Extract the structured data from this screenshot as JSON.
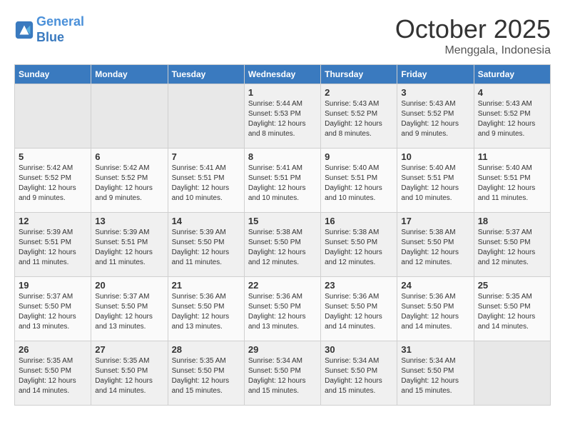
{
  "header": {
    "logo_line1": "General",
    "logo_line2": "Blue",
    "month": "October 2025",
    "location": "Menggala, Indonesia"
  },
  "weekdays": [
    "Sunday",
    "Monday",
    "Tuesday",
    "Wednesday",
    "Thursday",
    "Friday",
    "Saturday"
  ],
  "weeks": [
    [
      {
        "day": "",
        "info": ""
      },
      {
        "day": "",
        "info": ""
      },
      {
        "day": "",
        "info": ""
      },
      {
        "day": "1",
        "info": "Sunrise: 5:44 AM\nSunset: 5:53 PM\nDaylight: 12 hours\nand 8 minutes."
      },
      {
        "day": "2",
        "info": "Sunrise: 5:43 AM\nSunset: 5:52 PM\nDaylight: 12 hours\nand 8 minutes."
      },
      {
        "day": "3",
        "info": "Sunrise: 5:43 AM\nSunset: 5:52 PM\nDaylight: 12 hours\nand 9 minutes."
      },
      {
        "day": "4",
        "info": "Sunrise: 5:43 AM\nSunset: 5:52 PM\nDaylight: 12 hours\nand 9 minutes."
      }
    ],
    [
      {
        "day": "5",
        "info": "Sunrise: 5:42 AM\nSunset: 5:52 PM\nDaylight: 12 hours\nand 9 minutes."
      },
      {
        "day": "6",
        "info": "Sunrise: 5:42 AM\nSunset: 5:52 PM\nDaylight: 12 hours\nand 9 minutes."
      },
      {
        "day": "7",
        "info": "Sunrise: 5:41 AM\nSunset: 5:51 PM\nDaylight: 12 hours\nand 10 minutes."
      },
      {
        "day": "8",
        "info": "Sunrise: 5:41 AM\nSunset: 5:51 PM\nDaylight: 12 hours\nand 10 minutes."
      },
      {
        "day": "9",
        "info": "Sunrise: 5:40 AM\nSunset: 5:51 PM\nDaylight: 12 hours\nand 10 minutes."
      },
      {
        "day": "10",
        "info": "Sunrise: 5:40 AM\nSunset: 5:51 PM\nDaylight: 12 hours\nand 10 minutes."
      },
      {
        "day": "11",
        "info": "Sunrise: 5:40 AM\nSunset: 5:51 PM\nDaylight: 12 hours\nand 11 minutes."
      }
    ],
    [
      {
        "day": "12",
        "info": "Sunrise: 5:39 AM\nSunset: 5:51 PM\nDaylight: 12 hours\nand 11 minutes."
      },
      {
        "day": "13",
        "info": "Sunrise: 5:39 AM\nSunset: 5:51 PM\nDaylight: 12 hours\nand 11 minutes."
      },
      {
        "day": "14",
        "info": "Sunrise: 5:39 AM\nSunset: 5:50 PM\nDaylight: 12 hours\nand 11 minutes."
      },
      {
        "day": "15",
        "info": "Sunrise: 5:38 AM\nSunset: 5:50 PM\nDaylight: 12 hours\nand 12 minutes."
      },
      {
        "day": "16",
        "info": "Sunrise: 5:38 AM\nSunset: 5:50 PM\nDaylight: 12 hours\nand 12 minutes."
      },
      {
        "day": "17",
        "info": "Sunrise: 5:38 AM\nSunset: 5:50 PM\nDaylight: 12 hours\nand 12 minutes."
      },
      {
        "day": "18",
        "info": "Sunrise: 5:37 AM\nSunset: 5:50 PM\nDaylight: 12 hours\nand 12 minutes."
      }
    ],
    [
      {
        "day": "19",
        "info": "Sunrise: 5:37 AM\nSunset: 5:50 PM\nDaylight: 12 hours\nand 13 minutes."
      },
      {
        "day": "20",
        "info": "Sunrise: 5:37 AM\nSunset: 5:50 PM\nDaylight: 12 hours\nand 13 minutes."
      },
      {
        "day": "21",
        "info": "Sunrise: 5:36 AM\nSunset: 5:50 PM\nDaylight: 12 hours\nand 13 minutes."
      },
      {
        "day": "22",
        "info": "Sunrise: 5:36 AM\nSunset: 5:50 PM\nDaylight: 12 hours\nand 13 minutes."
      },
      {
        "day": "23",
        "info": "Sunrise: 5:36 AM\nSunset: 5:50 PM\nDaylight: 12 hours\nand 14 minutes."
      },
      {
        "day": "24",
        "info": "Sunrise: 5:36 AM\nSunset: 5:50 PM\nDaylight: 12 hours\nand 14 minutes."
      },
      {
        "day": "25",
        "info": "Sunrise: 5:35 AM\nSunset: 5:50 PM\nDaylight: 12 hours\nand 14 minutes."
      }
    ],
    [
      {
        "day": "26",
        "info": "Sunrise: 5:35 AM\nSunset: 5:50 PM\nDaylight: 12 hours\nand 14 minutes."
      },
      {
        "day": "27",
        "info": "Sunrise: 5:35 AM\nSunset: 5:50 PM\nDaylight: 12 hours\nand 14 minutes."
      },
      {
        "day": "28",
        "info": "Sunrise: 5:35 AM\nSunset: 5:50 PM\nDaylight: 12 hours\nand 15 minutes."
      },
      {
        "day": "29",
        "info": "Sunrise: 5:34 AM\nSunset: 5:50 PM\nDaylight: 12 hours\nand 15 minutes."
      },
      {
        "day": "30",
        "info": "Sunrise: 5:34 AM\nSunset: 5:50 PM\nDaylight: 12 hours\nand 15 minutes."
      },
      {
        "day": "31",
        "info": "Sunrise: 5:34 AM\nSunset: 5:50 PM\nDaylight: 12 hours\nand 15 minutes."
      },
      {
        "day": "",
        "info": ""
      }
    ]
  ]
}
